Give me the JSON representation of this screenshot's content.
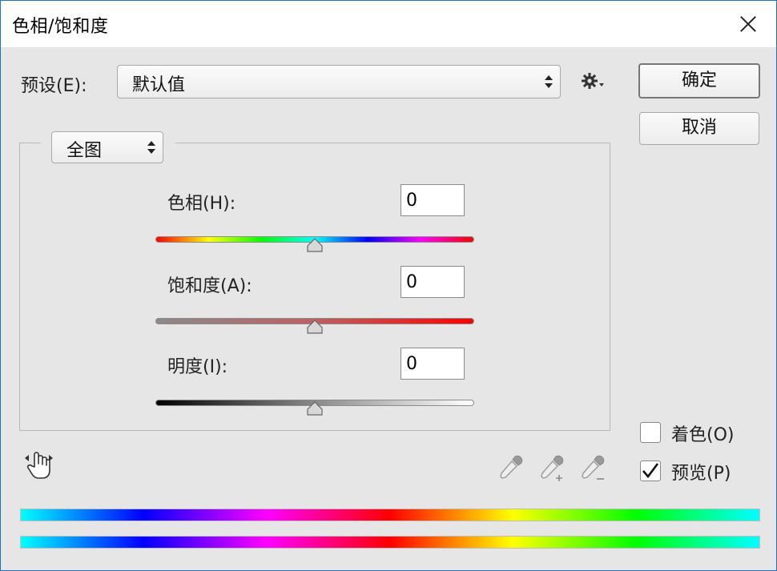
{
  "window": {
    "title": "色相/饱和度"
  },
  "preset": {
    "label": "预设(E):",
    "value": "默认值"
  },
  "buttons": {
    "ok": "确定",
    "cancel": "取消"
  },
  "channel": {
    "value": "全图"
  },
  "sliders": {
    "hue": {
      "label": "色相(H):",
      "value": "0",
      "level": 0
    },
    "saturation": {
      "label": "饱和度(A):",
      "value": "0",
      "level": 0
    },
    "lightness": {
      "label": "明度(I):",
      "value": "0",
      "level": 0
    }
  },
  "options": {
    "colorize": {
      "label": "着色(O)",
      "checked": false
    },
    "preview": {
      "label": "预览(P)",
      "checked": true
    }
  },
  "icons": {
    "settings": "gear-icon",
    "target_adjust": "hand-adjust-icon",
    "eyedropper": "eyedropper-icon",
    "eyedropper_add": "eyedropper-plus-icon",
    "eyedropper_subtract": "eyedropper-minus-icon",
    "close": "close-icon"
  },
  "colors": {
    "accent_border": "#1a73c9",
    "dialog_bg": "#e6e6e6"
  }
}
